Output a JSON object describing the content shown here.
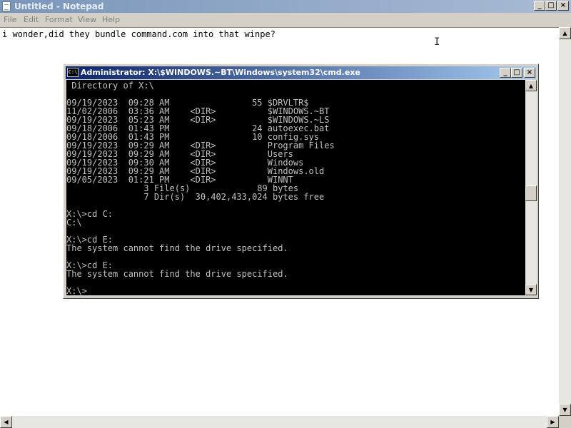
{
  "notepad": {
    "title": "Untitled - Notepad",
    "menu": [
      "File",
      "Edit",
      "Format",
      "View",
      "Help"
    ],
    "text": "i wonder,did they bundle command.com into that winpe?",
    "caption_buttons": {
      "minimize": "_",
      "maximize": "□",
      "close": "×"
    }
  },
  "cmd": {
    "title": "Administrator: X:\\$WINDOWS.~BT\\Windows\\system32\\cmd.exe",
    "icon_text": "C:\\",
    "caption_buttons": {
      "minimize": "_",
      "maximize": "□",
      "close": "×"
    },
    "lines": [
      " Directory of X:\\",
      "",
      "09/19/2023  09:28 AM                55 $DRVLTR$",
      "11/02/2006  03:36 AM    <DIR>          $WINDOWS.~BT",
      "09/19/2023  05:23 AM    <DIR>          $WINDOWS.~LS",
      "09/18/2006  01:43 PM                24 autoexec.bat",
      "09/18/2006  01:43 PM                10 config.sys",
      "09/19/2023  09:29 AM    <DIR>          Program Files",
      "09/19/2023  09:29 AM    <DIR>          Users",
      "09/19/2023  09:30 AM    <DIR>          Windows",
      "09/19/2023  09:29 AM    <DIR>          Windows.old",
      "09/05/2023  01:21 PM    <DIR>          WINNT",
      "               3 File(s)             89 bytes",
      "               7 Dir(s)  30,402,433,024 bytes free",
      "",
      "X:\\>cd C:",
      "C:\\",
      "",
      "X:\\>cd E:",
      "The system cannot find the drive specified.",
      "",
      "X:\\>cd E:",
      "The system cannot find the drive specified.",
      "",
      "X:\\>_"
    ]
  },
  "scroll_arrows": {
    "up": "▲",
    "down": "▼",
    "left": "◀",
    "right": "▶"
  },
  "cursor_glyph": "I"
}
